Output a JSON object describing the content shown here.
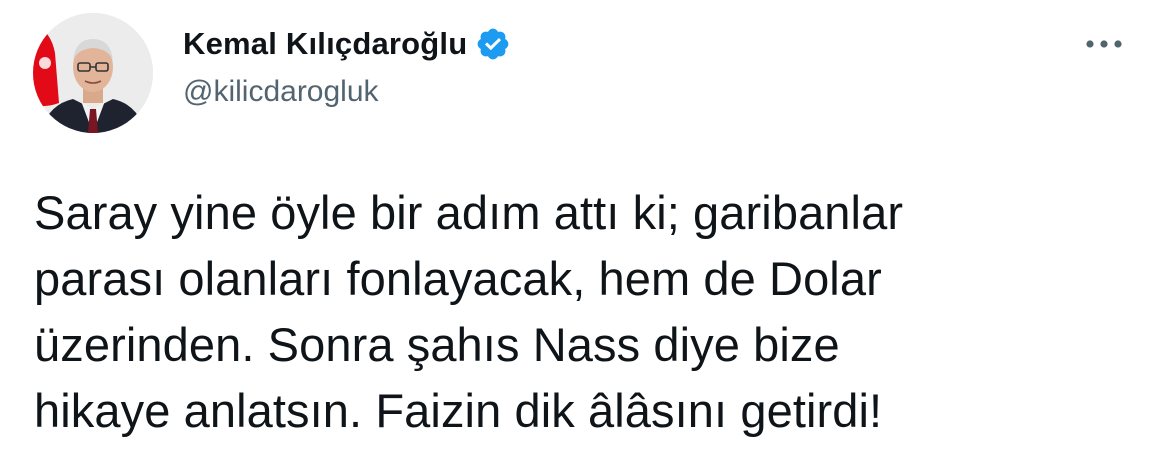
{
  "author": {
    "name": "Kemal Kılıçdaroğlu",
    "handle": "@kilicdarogluk",
    "verified": true,
    "verified_color": "#1d9bf0"
  },
  "avatar": {
    "icon": "profile-photo",
    "flag_color": "#e30a17"
  },
  "more_menu": {
    "icon": "more-horizontal-icon"
  },
  "tweet": {
    "lines": [
      "Saray yine öyle bir adım attı ki; garibanlar",
      "parası olanları fonlayacak, hem de Dolar",
      "üzerinden. Sonra şahıs Nass diye bize",
      "hikaye anlatsın. Faizin dik âlâsını getirdi!"
    ]
  }
}
